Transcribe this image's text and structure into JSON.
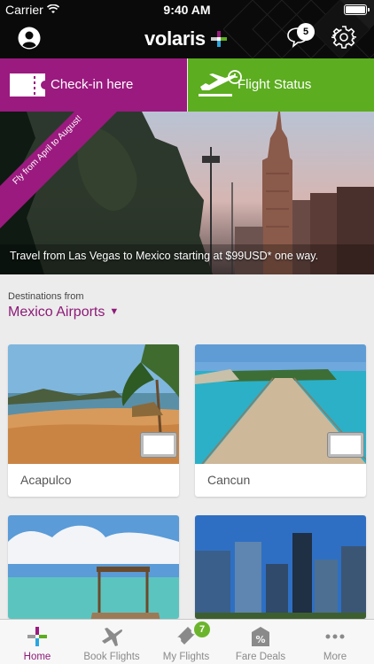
{
  "status_bar": {
    "carrier": "Carrier",
    "time": "9:40 AM"
  },
  "header": {
    "logo_text": "volaris",
    "notifications_count": "5"
  },
  "actions": {
    "checkin_label": "Check-in here",
    "flight_status_label": "Flight Status"
  },
  "hero": {
    "ribbon_text": "Fly from April to August!",
    "caption": "Travel from Las Vegas to Mexico starting at $99USD* one way."
  },
  "destinations": {
    "label": "Destinations from",
    "selected": "Mexico Airports"
  },
  "cards": [
    {
      "name": "Acapulco"
    },
    {
      "name": "Cancun"
    },
    {
      "name": ""
    },
    {
      "name": ""
    }
  ],
  "tabs": [
    {
      "label": "Home",
      "icon": "volaris-star-icon"
    },
    {
      "label": "Book Flights",
      "icon": "airplane-icon"
    },
    {
      "label": "My Flights",
      "icon": "ticket-icon",
      "badge": "7"
    },
    {
      "label": "Fare Deals",
      "icon": "percent-tag-icon"
    },
    {
      "label": "More",
      "icon": "more-dots-icon"
    }
  ],
  "colors": {
    "brand_purple": "#9b1a7f",
    "brand_green": "#5cad1f",
    "header_bg": "#0a0a0a"
  }
}
